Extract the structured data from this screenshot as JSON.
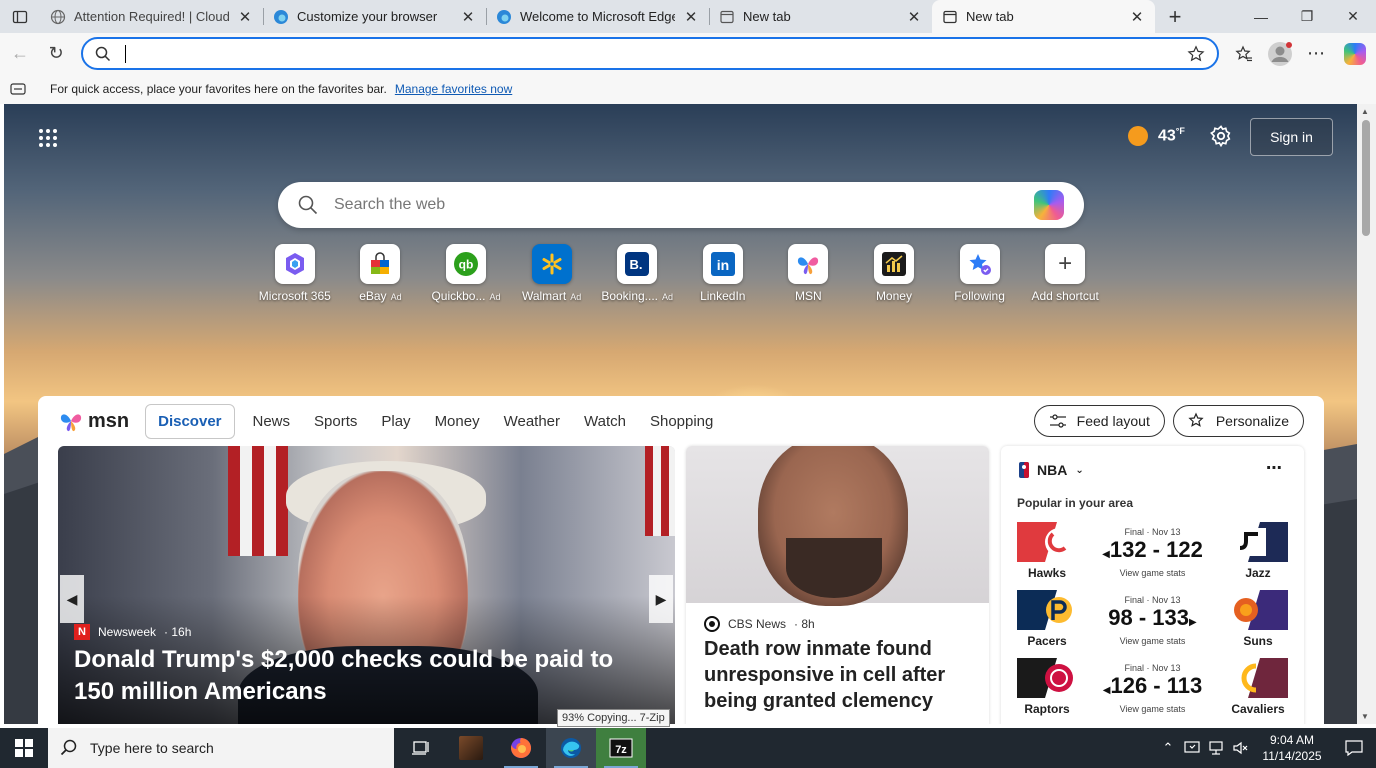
{
  "browser": {
    "tabs": [
      {
        "title": "Attention Required! | Cloudflare",
        "icon": "globe-icon"
      },
      {
        "title": "Customize your browser",
        "icon": "edge-icon"
      },
      {
        "title": "Welcome to Microsoft Edge",
        "icon": "edge-icon"
      },
      {
        "title": "New tab",
        "icon": "newtab-icon"
      },
      {
        "title": "New tab",
        "icon": "newtab-icon",
        "active": true
      }
    ],
    "address_value": "",
    "favorites_bar": {
      "message": "For quick access, place your favorites here on the favorites bar.",
      "link": "Manage favorites now"
    }
  },
  "ntp": {
    "weather_temp": "43",
    "weather_unit": "°F",
    "sign_in": "Sign in",
    "search_placeholder": "Search the web",
    "shortcuts": [
      {
        "label": "Microsoft 365",
        "ad": ""
      },
      {
        "label": "eBay",
        "ad": "Ad"
      },
      {
        "label": "Quickbo...",
        "ad": "Ad"
      },
      {
        "label": "Walmart",
        "ad": "Ad"
      },
      {
        "label": "Booking....",
        "ad": "Ad"
      },
      {
        "label": "LinkedIn",
        "ad": ""
      },
      {
        "label": "MSN",
        "ad": ""
      },
      {
        "label": "Money",
        "ad": ""
      },
      {
        "label": "Following",
        "ad": ""
      },
      {
        "label": "Add shortcut",
        "ad": ""
      }
    ]
  },
  "feed": {
    "brand": "msn",
    "tabs": [
      "Discover",
      "News",
      "Sports",
      "Play",
      "Money",
      "Weather",
      "Watch",
      "Shopping"
    ],
    "feed_layout": "Feed layout",
    "personalize": "Personalize",
    "hero": {
      "source": "Newsweek",
      "age": "· 16h",
      "headline": "Donald Trump's $2,000 checks could be paid to 150 million Americans"
    },
    "card2": {
      "source": "CBS News",
      "age": "· 8h",
      "headline": "Death row inmate found unresponsive in cell after being granted clemency"
    },
    "sports": {
      "league": "NBA",
      "subtitle": "Popular in your area",
      "games": [
        {
          "status": "Final · Nov 13",
          "home": "Hawks",
          "away": "Jazz",
          "score": "132 - 122",
          "winner": "left",
          "link": "View game stats",
          "home_color": "#e03a3e",
          "away_color": "#1d2a56"
        },
        {
          "status": "Final · Nov 13",
          "home": "Pacers",
          "away": "Suns",
          "score": "98 - 133",
          "winner": "right",
          "link": "View game stats",
          "home_color": "#0c2c56",
          "away_color": "#3b2a7a"
        },
        {
          "status": "Final · Nov 13",
          "home": "Raptors",
          "away": "Cavaliers",
          "score": "126 - 113",
          "winner": "left",
          "link": "View game stats",
          "home_color": "#1a1a1a",
          "away_color": "#6f263d"
        }
      ]
    }
  },
  "toast": "93% Copying... 7-Zip",
  "taskbar": {
    "search_placeholder": "Type here to search",
    "time": "9:04 AM",
    "date": "11/14/2025"
  }
}
